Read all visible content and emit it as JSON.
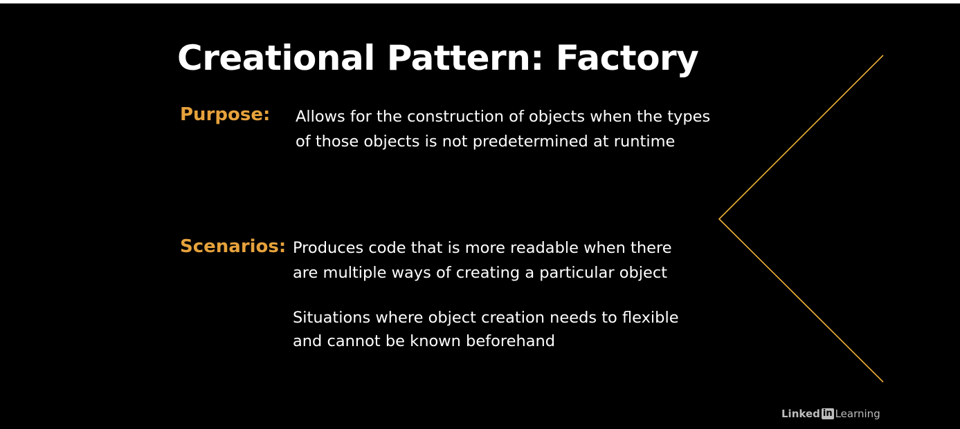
{
  "slide": {
    "title": "Creational Pattern: Factory",
    "purpose": {
      "label": "Purpose:",
      "lines": [
        "Allows for the construction of objects when the types",
        "of those objects is not predetermined at runtime"
      ]
    },
    "scenarios": {
      "label": "Scenarios:",
      "items": [
        {
          "lines": [
            "Produces code that is more readable when there",
            "are multiple ways of creating a particular object"
          ]
        },
        {
          "lines": [
            "Situations where object creation needs to flexible",
            "and cannot be known beforehand"
          ]
        }
      ]
    },
    "accent_color": "#E6A23C",
    "line_color": "#F0B23A"
  },
  "branding": {
    "logo_text": "LinkedIn Learning"
  }
}
